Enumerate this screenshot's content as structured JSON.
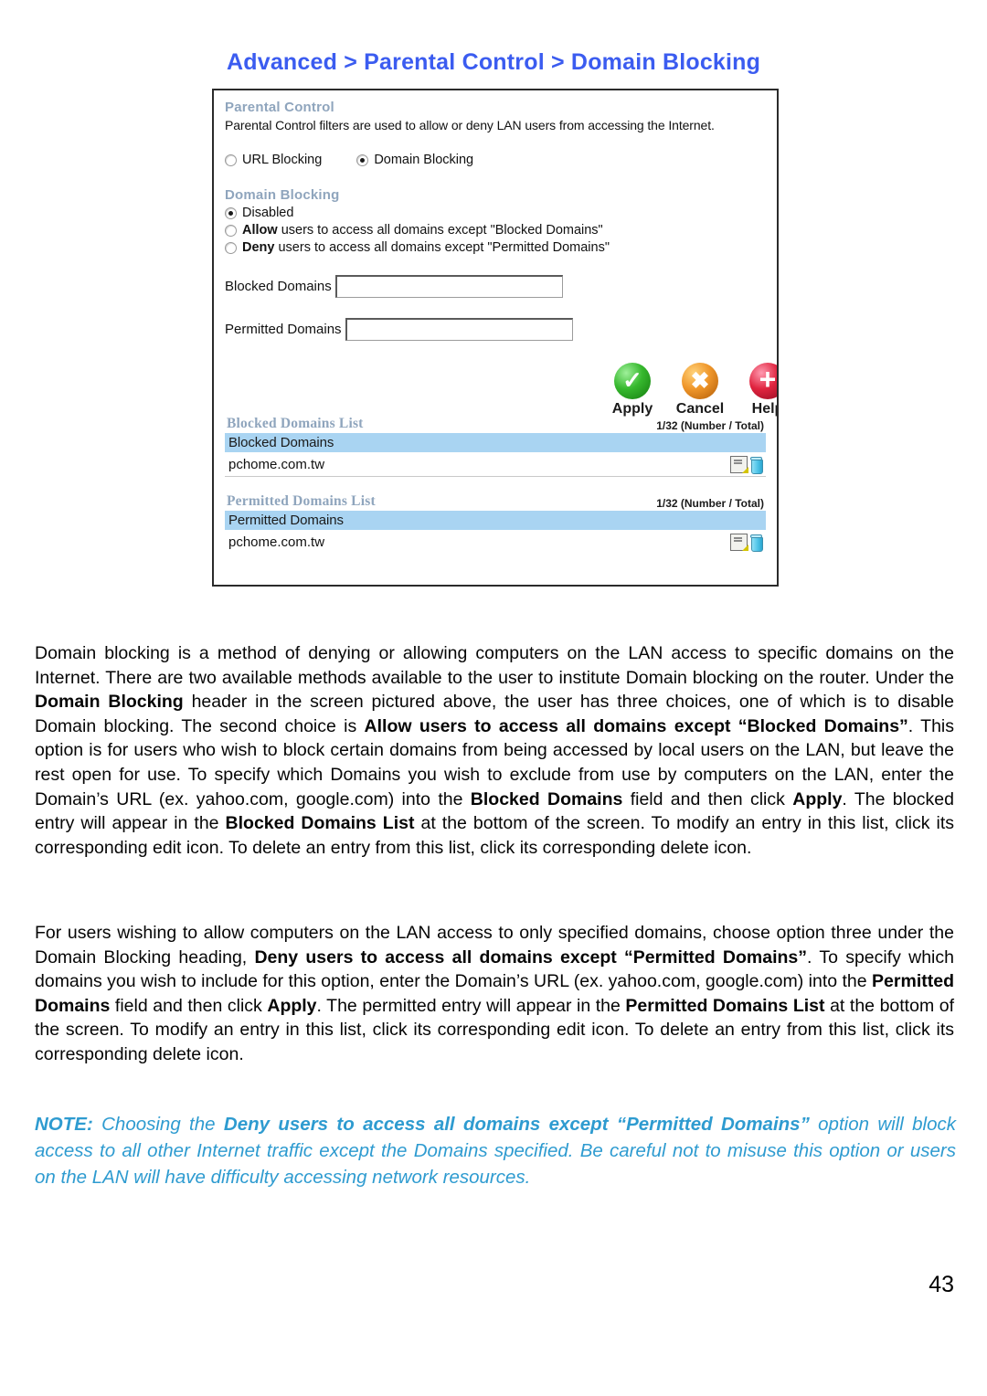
{
  "page": {
    "title": "Advanced > Parental Control > Domain Blocking",
    "title_color": "#3b5cf0",
    "number": "43"
  },
  "router_ui": {
    "parental_control": {
      "heading": "Parental Control",
      "description": "Parental Control filters are used to allow or deny LAN users from accessing the Internet.",
      "mode_options": [
        {
          "label": "URL Blocking",
          "selected": false
        },
        {
          "label": "Domain Blocking",
          "selected": true
        }
      ]
    },
    "domain_blocking": {
      "heading": "Domain Blocking",
      "options": [
        {
          "bold": "",
          "label": "Disabled",
          "selected": true
        },
        {
          "bold": "Allow",
          "label": " users to access all domains except \"Blocked Domains\"",
          "selected": false
        },
        {
          "bold": "Deny",
          "label": " users to access all domains except \"Permitted Domains\"",
          "selected": false
        }
      ],
      "fields": [
        {
          "label": "Blocked Domains",
          "value": "",
          "placeholder": ""
        },
        {
          "label": "Permitted Domains",
          "value": "",
          "placeholder": ""
        }
      ]
    },
    "actions": [
      {
        "label": "Apply",
        "icon": "check-circle-icon",
        "color": "#36b82e"
      },
      {
        "label": "Cancel",
        "icon": "x-circle-icon",
        "color": "#ef962a"
      },
      {
        "label": "Help",
        "icon": "plus-circle-icon",
        "color": "#e0243f"
      }
    ],
    "blocked_list": {
      "heading": "Blocked Domains List",
      "count": "1/32 (Number / Total)",
      "column_header": "Blocked Domains",
      "rows": [
        {
          "domain": "pchome.com.tw",
          "edit_icon": "edit-icon",
          "delete_icon": "delete-icon"
        }
      ]
    },
    "permitted_list": {
      "heading": "Permitted Domains List",
      "count": "1/32 (Number / Total)",
      "column_header": "Permitted Domains",
      "rows": [
        {
          "domain": "pchome.com.tw",
          "edit_icon": "edit-icon",
          "delete_icon": "delete-icon"
        }
      ]
    },
    "colors": {
      "section_heading": "#8fa5bd",
      "list_header_row": "#a9d4f2",
      "panel_border": "#2b2b2b"
    }
  },
  "body": {
    "paragraph1_html": "Domain blocking is a method of denying or allowing computers on the LAN access to specific domains on the Internet. There are two available methods available to the user to institute Domain blocking on the router. Under the <b>Domain Blocking</b> header in the screen pictured above, the user has three choices, one of which is to disable Domain blocking. The second choice is <b>Allow users to access all domains except &ldquo;Blocked Domains&rdquo;</b>. This option is for users who wish to block certain domains from being accessed by local users on the LAN, but leave the rest open for use. To specify which Domains you wish to exclude from use by computers on the LAN, enter the Domain&rsquo;s URL (ex. yahoo.com, google.com) into the <b>Blocked Domains</b> field and then click <b>Apply</b>. The blocked entry will appear in the <b>Blocked Domains List</b> at the bottom of the screen. To modify an entry in this list, click its corresponding edit icon. To delete an entry from this list, click its corresponding delete icon.",
    "paragraph2_html": "For users wishing to allow computers on the LAN access to only specified domains, choose option three under the Domain Blocking heading, <b>Deny users to access all domains except &ldquo;Permitted Domains&rdquo;</b>. To specify which domains you wish to include for this option, enter the Domain&rsquo;s URL (ex. yahoo.com, google.com) into the <b>Permitted Domains</b> field and then click <b>Apply</b>. The permitted entry will appear in the <b>Permitted Domains List</b> at the bottom of the screen. To modify an entry in this list, click its corresponding edit icon. To delete an entry from this list, click its corresponding delete icon.",
    "note_html": "<b>NOTE:</b> Choosing the <b>Deny users to access all domains except &ldquo;Permitted Domains&rdquo;</b> option will block access to all other Internet traffic except the Domains specified. Be careful not to misuse this option or users on the LAN will have difficulty accessing network resources.",
    "note_color": "#2e9bd0"
  }
}
